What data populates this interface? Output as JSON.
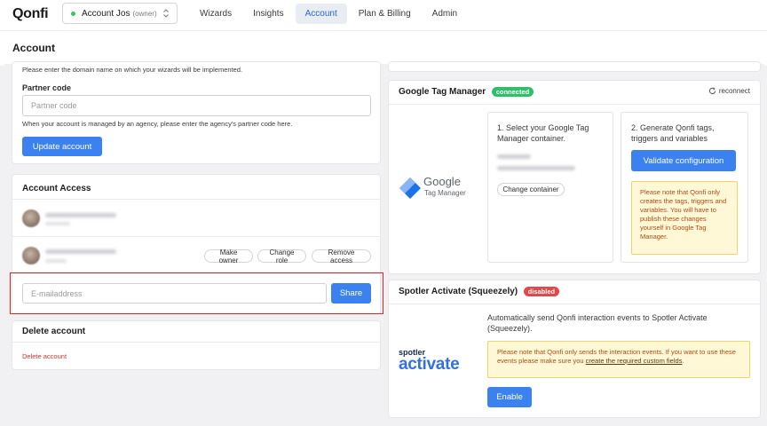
{
  "brand": {
    "logo": "Qonfi"
  },
  "account_switcher": {
    "name": "Account Jos",
    "role": "(owner)"
  },
  "nav": {
    "items": [
      {
        "label": "Wizards",
        "active": false
      },
      {
        "label": "Insights",
        "active": false
      },
      {
        "label": "Account",
        "active": true
      },
      {
        "label": "Plan & Billing",
        "active": false
      },
      {
        "label": "Admin",
        "active": false
      }
    ]
  },
  "page": {
    "title": "Account"
  },
  "account_form": {
    "domain_hint": "Please enter the domain name on which your wizards will be implemented.",
    "partner_label": "Partner code",
    "partner_placeholder": "Partner code",
    "partner_hint": "When your account is managed by an agency, please enter the agency's partner code here.",
    "update_button": "Update account"
  },
  "account_access": {
    "title": "Account Access",
    "row_actions": {
      "make_owner": "Make owner",
      "change_role": "Change role",
      "remove_access": "Remove access"
    },
    "email_placeholder": "E-mailaddress",
    "share_button": "Share"
  },
  "delete_account": {
    "title": "Delete account",
    "link": "Delete account"
  },
  "gtm": {
    "title": "Google Tag Manager",
    "status": "connected",
    "reconnect": "reconnect",
    "logo_line1": "Google",
    "logo_line2": "Tag Manager",
    "step1": "1. Select your Google Tag Manager container.",
    "change_container": "Change container",
    "step2": "2. Generate Qonfi tags, triggers and variables",
    "validate_button": "Validate configuration",
    "note": "Please note that Qonfi only creates the tags, triggers and variables. You will have to publish these changes yourself in Google Tag Manager."
  },
  "spotler": {
    "title": "Spotler Activate (Squeezely)",
    "status": "disabled",
    "logo_line1": "spotler",
    "logo_line2": "activate",
    "description": "Automatically send Qonfi interaction events to Spotler Activate (Squeezely).",
    "note_text": "Please note that Qonfi only sends the interaction events. If you want to use these events please make sure you ",
    "note_link": "create the required custom fields",
    "note_end": ".",
    "enable_button": "Enable"
  },
  "colors": {
    "accent": "#3b82f0",
    "connected": "#2fbf6b",
    "disabled": "#e14848",
    "highlight": "#e02424"
  }
}
